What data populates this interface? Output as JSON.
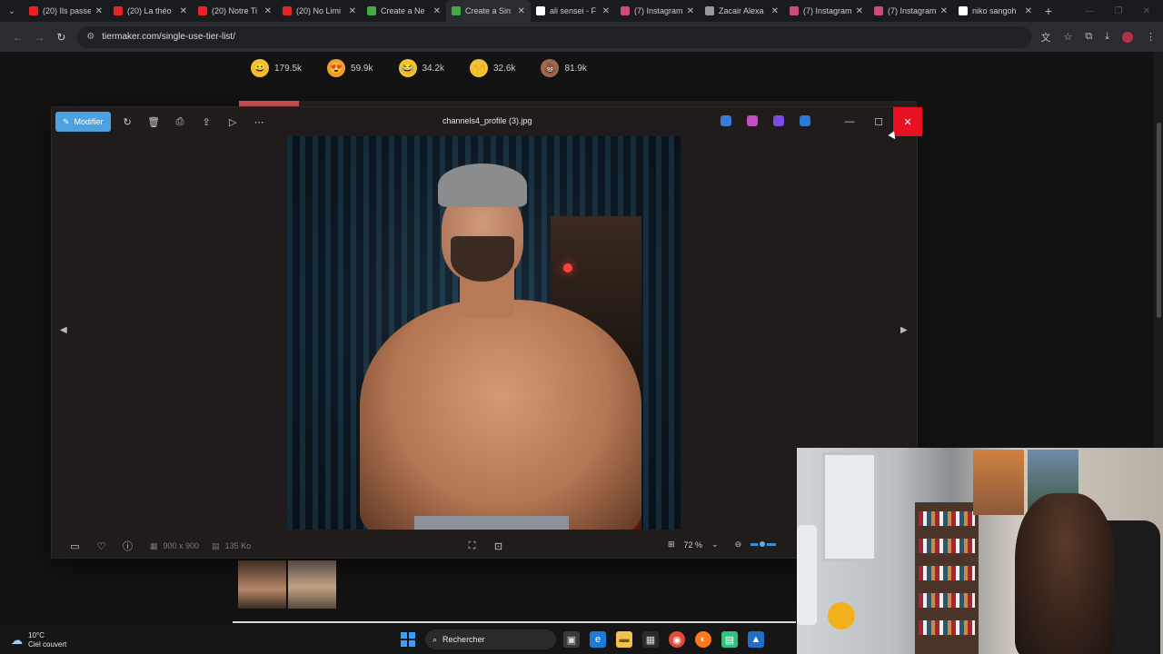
{
  "browser": {
    "tabs": [
      {
        "label": "(20) Ils passe",
        "color": "#e22"
      },
      {
        "label": "(20) La théo",
        "color": "#e22"
      },
      {
        "label": "(20) Notre Ti",
        "color": "#e22"
      },
      {
        "label": "(20) No Limi",
        "color": "#e22"
      },
      {
        "label": "Create a Ne",
        "color": "#4a4"
      },
      {
        "label": "Create a Sin",
        "color": "#4a4",
        "active": true
      },
      {
        "label": "ali sensei - F",
        "color": "#fff"
      },
      {
        "label": "(7) Instagram",
        "color": "#d3487a"
      },
      {
        "label": "Zacair Alexa",
        "color": "#999"
      },
      {
        "label": "(7) Instagram",
        "color": "#d3487a"
      },
      {
        "label": "(7) Instagram",
        "color": "#d3487a"
      },
      {
        "label": "niko sangoh",
        "color": "#fff"
      }
    ],
    "url": "tiermaker.com/single-use-tier-list/"
  },
  "reactions": [
    {
      "emoji": "😀",
      "count": "179.5k",
      "bg": "#f1c232"
    },
    {
      "emoji": "😍",
      "count": "59.9k",
      "bg": "#f0a030"
    },
    {
      "emoji": "😂",
      "count": "34.2k",
      "bg": "#f1c232"
    },
    {
      "emoji": "🙌",
      "count": "32.6k",
      "bg": "#f1c232"
    },
    {
      "emoji": "💩",
      "count": "81.9k",
      "bg": "#a06a4a"
    }
  ],
  "viewer": {
    "edit_label": "Modifier",
    "filename": "channels4_profile (3).jpg",
    "dimensions": "900 x 900",
    "filesize": "135 Ko",
    "zoom": "72 %"
  },
  "taskbar": {
    "temperature": "10°C",
    "weather": "Ciel couvert",
    "search_label": "Rechercher"
  }
}
